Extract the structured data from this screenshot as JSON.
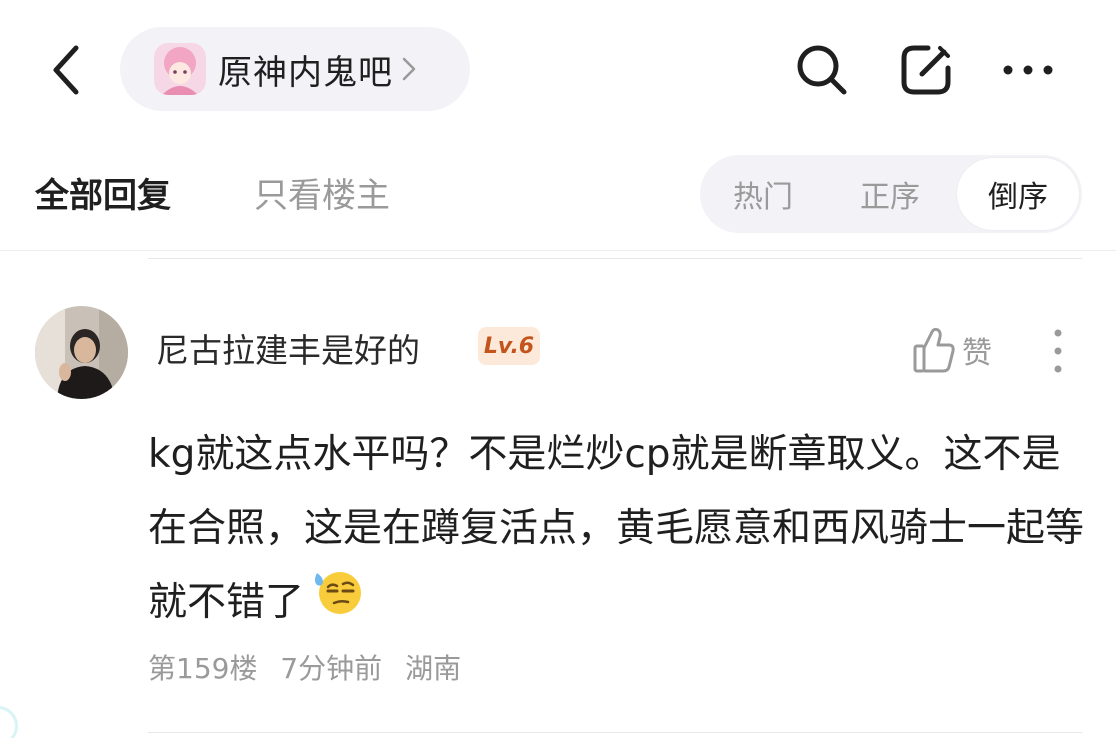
{
  "header": {
    "forum_name": "原神内鬼吧",
    "icons": {
      "back": "back-arrow-icon",
      "search": "search-icon",
      "edit": "edit-icon",
      "more": "more-horizontal-icon",
      "chevron": "chevron-right-icon"
    }
  },
  "tabs": {
    "all_replies": "全部回复",
    "op_only": "只看楼主"
  },
  "sort": {
    "options": [
      "热门",
      "正序",
      "倒序"
    ],
    "selected": "倒序"
  },
  "post": {
    "username": "尼古拉建丰是好的",
    "level": "Lv.6",
    "like_label": "赞",
    "content": "kg就这点水平吗？不是烂炒cp就是断章取义。这不是在合照，这是在蹲复活点，黄毛愿意和西风骑士一起等就不错了",
    "emoji": "sweat-smirk-emoji",
    "floor": "第159楼",
    "time": "7分钟前",
    "location": "湖南"
  },
  "colors": {
    "accent_bg": "#f3f3f7",
    "muted_text": "#9a9a9a",
    "level_bg": "#fde9d9",
    "level_text": "#c2541c"
  }
}
